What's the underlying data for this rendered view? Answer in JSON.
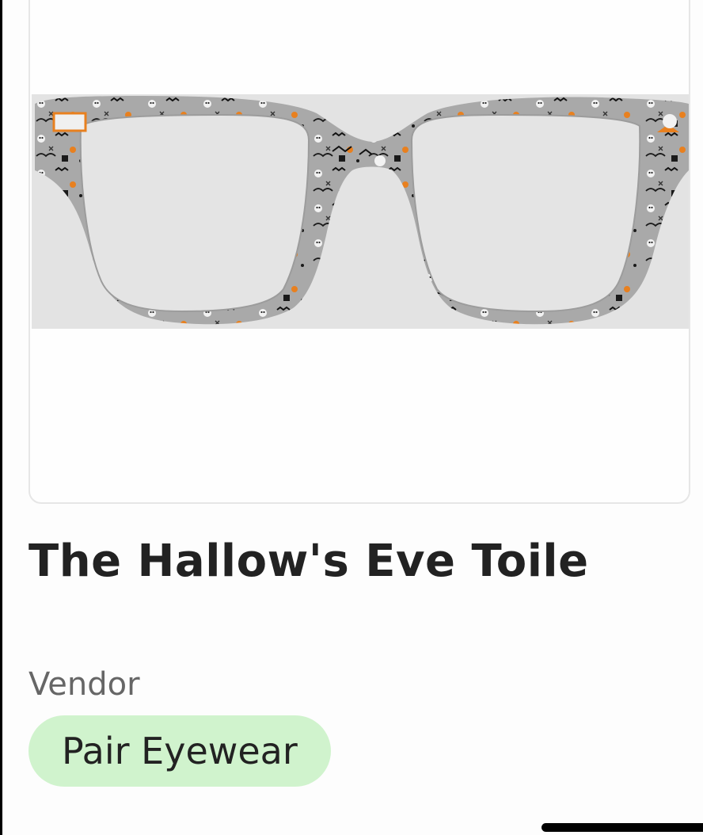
{
  "product": {
    "title": "The Hallow's Eve Toile",
    "image_description_icon": "eyeglasses-image",
    "vendor_label": "Vendor",
    "vendor_name": "Pair Eyewear"
  },
  "colors": {
    "frame_pattern": "#a9a9a9",
    "accent_orange": "#e8801f",
    "vendor_chip_bg": "#d0f3cd",
    "title_text": "#222222",
    "label_text": "#666666"
  }
}
